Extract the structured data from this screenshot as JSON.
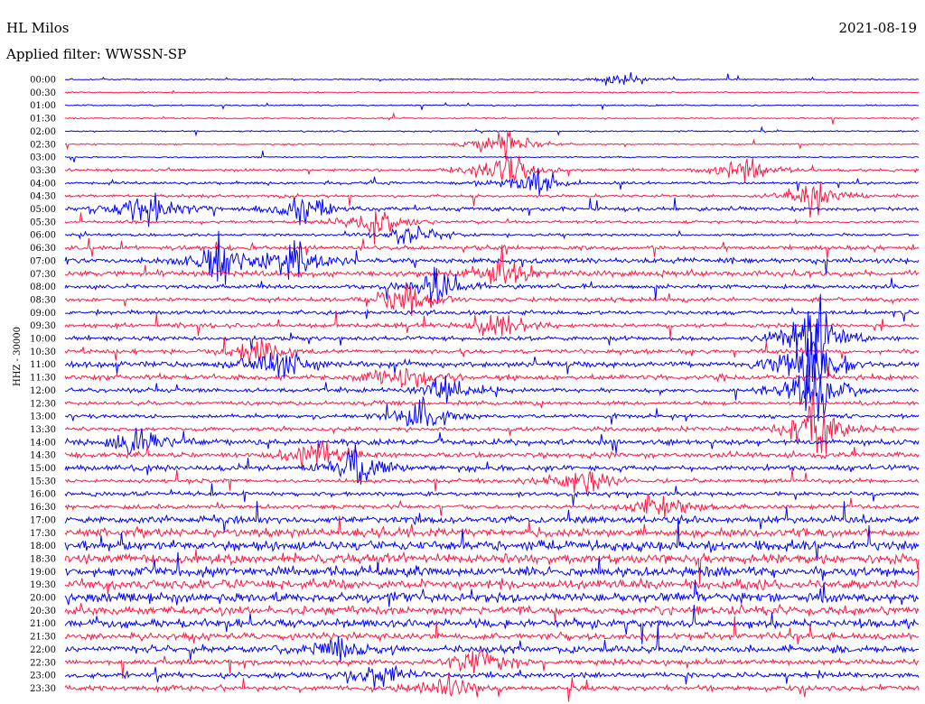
{
  "header": {
    "station": "HL Milos",
    "date": "2021-08-19",
    "filter": "Applied filter: WWSSN-SP"
  },
  "chart_data": {
    "type": "line",
    "title": "HL Milos",
    "date": "2021-08-19",
    "subtitle": "Applied filter: WWSSN-SP",
    "ylabel": "HHZ - 30000",
    "xlabel": "",
    "categories": [
      "00:00",
      "00:30",
      "01:00",
      "01:30",
      "02:00",
      "02:30",
      "03:00",
      "03:30",
      "04:00",
      "04:30",
      "05:00",
      "05:30",
      "06:00",
      "06:30",
      "07:00",
      "07:30",
      "08:00",
      "08:30",
      "09:00",
      "09:30",
      "10:00",
      "10:30",
      "11:00",
      "11:30",
      "12:00",
      "12:30",
      "13:00",
      "13:30",
      "14:00",
      "14:30",
      "15:00",
      "15:30",
      "16:00",
      "16:30",
      "17:00",
      "17:30",
      "18:00",
      "18:30",
      "19:00",
      "19:30",
      "20:00",
      "20:30",
      "21:00",
      "21:30",
      "22:00",
      "22:30",
      "23:00",
      "23:30"
    ],
    "trace_colors": [
      "#0000ff",
      "#ff1744"
    ],
    "amplitude_levels": [
      1,
      1,
      1,
      1,
      1,
      1,
      1,
      2,
      2,
      2,
      3,
      2,
      2,
      3,
      4,
      4,
      3,
      3,
      3,
      3,
      3,
      3,
      4,
      4,
      3,
      3,
      3,
      3,
      4,
      4,
      4,
      3,
      3,
      3,
      5,
      6,
      7,
      7,
      7,
      7,
      7,
      6,
      6,
      5,
      5,
      4,
      4,
      4
    ],
    "events": [
      {
        "row": 0,
        "minute": 19.5,
        "amp": 10
      },
      {
        "row": 5,
        "minute": 15.4,
        "amp": 30
      },
      {
        "row": 7,
        "minute": 15.4,
        "amp": 38
      },
      {
        "row": 8,
        "minute": 16.5,
        "amp": 22
      },
      {
        "row": 7,
        "minute": 23.8,
        "amp": 28
      },
      {
        "row": 9,
        "minute": 26.3,
        "amp": 30
      },
      {
        "row": 10,
        "minute": 3.0,
        "amp": 32
      },
      {
        "row": 10,
        "minute": 8.5,
        "amp": 26
      },
      {
        "row": 11,
        "minute": 10.9,
        "amp": 28
      },
      {
        "row": 12,
        "minute": 12.2,
        "amp": 22
      },
      {
        "row": 14,
        "minute": 5.5,
        "amp": 40
      },
      {
        "row": 14,
        "minute": 8.0,
        "amp": 38
      },
      {
        "row": 15,
        "minute": 15.4,
        "amp": 40
      },
      {
        "row": 16,
        "minute": 13.0,
        "amp": 32
      },
      {
        "row": 17,
        "minute": 12.0,
        "amp": 30
      },
      {
        "row": 19,
        "minute": 15.2,
        "amp": 30
      },
      {
        "row": 21,
        "minute": 6.8,
        "amp": 28
      },
      {
        "row": 22,
        "minute": 7.5,
        "amp": 30
      },
      {
        "row": 23,
        "minute": 11.8,
        "amp": 30
      },
      {
        "row": 24,
        "minute": 13.5,
        "amp": 28
      },
      {
        "row": 26,
        "minute": 12.5,
        "amp": 30
      },
      {
        "row": 28,
        "minute": 2.5,
        "amp": 30
      },
      {
        "row": 29,
        "minute": 8.8,
        "amp": 34
      },
      {
        "row": 30,
        "minute": 10.3,
        "amp": 36
      },
      {
        "row": 31,
        "minute": 18.0,
        "amp": 32
      },
      {
        "row": 33,
        "minute": 20.8,
        "amp": 26
      },
      {
        "row": 44,
        "minute": 9.5,
        "amp": 24
      },
      {
        "row": 45,
        "minute": 14.6,
        "amp": 26
      },
      {
        "row": 46,
        "minute": 11.0,
        "amp": 20
      },
      {
        "row": 47,
        "minute": 13.3,
        "amp": 22
      },
      {
        "row": 20,
        "minute": 26.3,
        "amp": 70
      },
      {
        "row": 22,
        "minute": 26.2,
        "amp": 80
      },
      {
        "row": 24,
        "minute": 26.3,
        "amp": 60
      },
      {
        "row": 27,
        "minute": 26.3,
        "amp": 55
      }
    ]
  }
}
